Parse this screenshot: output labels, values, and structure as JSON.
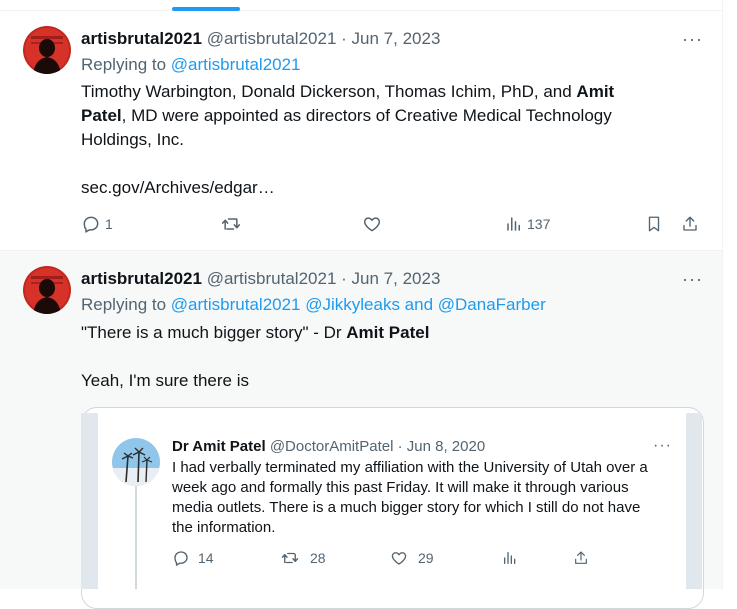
{
  "tweets": [
    {
      "display_name": "artisbrutal2021",
      "handle": "@artisbrutal2021",
      "sep": "·",
      "date": "Jun 7, 2023",
      "replying_label": "Replying to",
      "replying_to": "@artisbrutal2021",
      "text_1": "Timothy Warbington, Donald Dickerson, Thomas Ichim, PhD, and",
      "text_bold_1": "Amit",
      "text_bold_2": "Patel",
      "text_2": ", MD were appointed as directors of Creative Medical Technology",
      "text_3": "Holdings, Inc.",
      "link": "sec.gov/Archives/edgar…",
      "more": "···",
      "replies": "1",
      "retweets": "",
      "likes": "",
      "views": "137"
    },
    {
      "display_name": "artisbrutal2021",
      "handle": "@artisbrutal2021",
      "sep": "·",
      "date": "Jun 7, 2023",
      "replying_label": "Replying to",
      "replying_to": "@artisbrutal2021 @Jikkyleaks and @DanaFarber",
      "text_1": "\"There is a much bigger story\" - Dr",
      "text_bold": "Amit Patel",
      "text_2": "Yeah, I'm sure there is",
      "more": "···"
    }
  ],
  "quoted": {
    "display_name": "Dr Amit Patel",
    "handle": "@DoctorAmitPatel",
    "sep": "·",
    "date": "Jun 8, 2020",
    "more": "···",
    "lines": [
      "I had verbally terminated my affiliation with the University of Utah over a",
      "week ago and formally this past Friday.  It will make it through various",
      "media outlets.  There is a much bigger story for which I still do not have",
      "the information."
    ],
    "replies": "14",
    "retweets": "28",
    "likes": "29"
  },
  "colors": {
    "accent": "#1d9bf0",
    "text": "#0f1419",
    "muted": "#536471",
    "highlight_bg": "#f7f9f9"
  },
  "icons": [
    "reply-icon",
    "retweet-icon",
    "like-icon",
    "views-icon",
    "bookmark-icon",
    "share-icon",
    "more-icon"
  ]
}
